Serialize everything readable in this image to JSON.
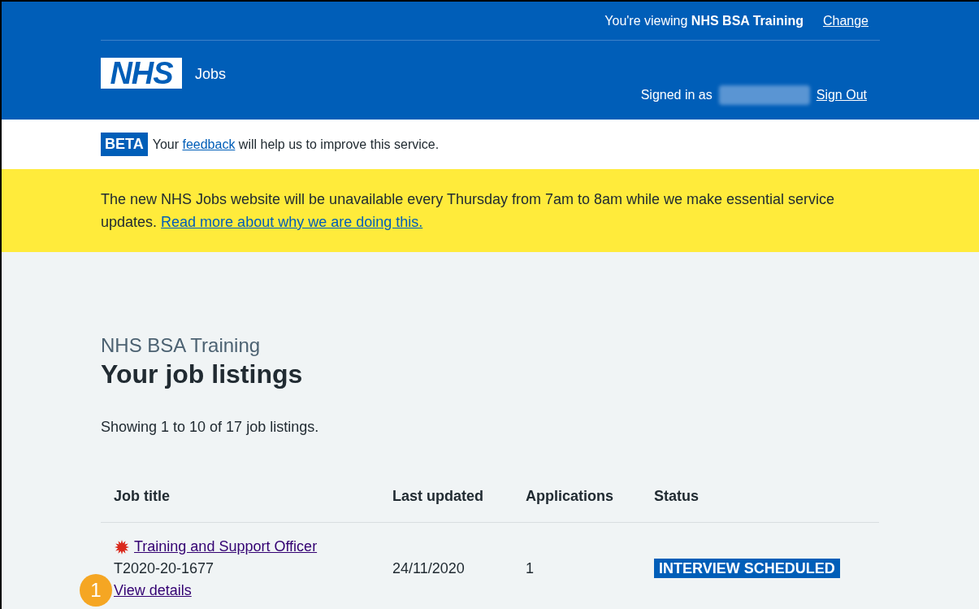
{
  "header": {
    "viewing_prefix": "You're viewing",
    "organisation": "NHS BSA Training",
    "change_link": "Change",
    "logo": "NHS",
    "service_name": "Jobs",
    "signed_in_label": "Signed in as",
    "sign_out_link": "Sign Out"
  },
  "beta_banner": {
    "tag": "BETA",
    "text_before": "Your",
    "link": "feedback",
    "text_after": "will help us to improve this service."
  },
  "notice": {
    "text": "The new NHS Jobs website will be unavailable every Thursday from 7am to 8am while we make essential service updates.",
    "link": "Read more about why we are doing this."
  },
  "page": {
    "caption": "NHS BSA Training",
    "heading": "Your job listings",
    "summary": "Showing 1 to 10 of 17 job listings."
  },
  "table": {
    "columns": [
      "Job title",
      "Last updated",
      "Applications",
      "Status"
    ],
    "rows": [
      {
        "title": "Training and Support Officer",
        "flagged": true,
        "reference": "T2020-20-1677",
        "details_link": "View details",
        "last_updated": "24/11/2020",
        "applications": "1",
        "status": "INTERVIEW SCHEDULED"
      }
    ]
  },
  "callout": {
    "number": "1"
  }
}
